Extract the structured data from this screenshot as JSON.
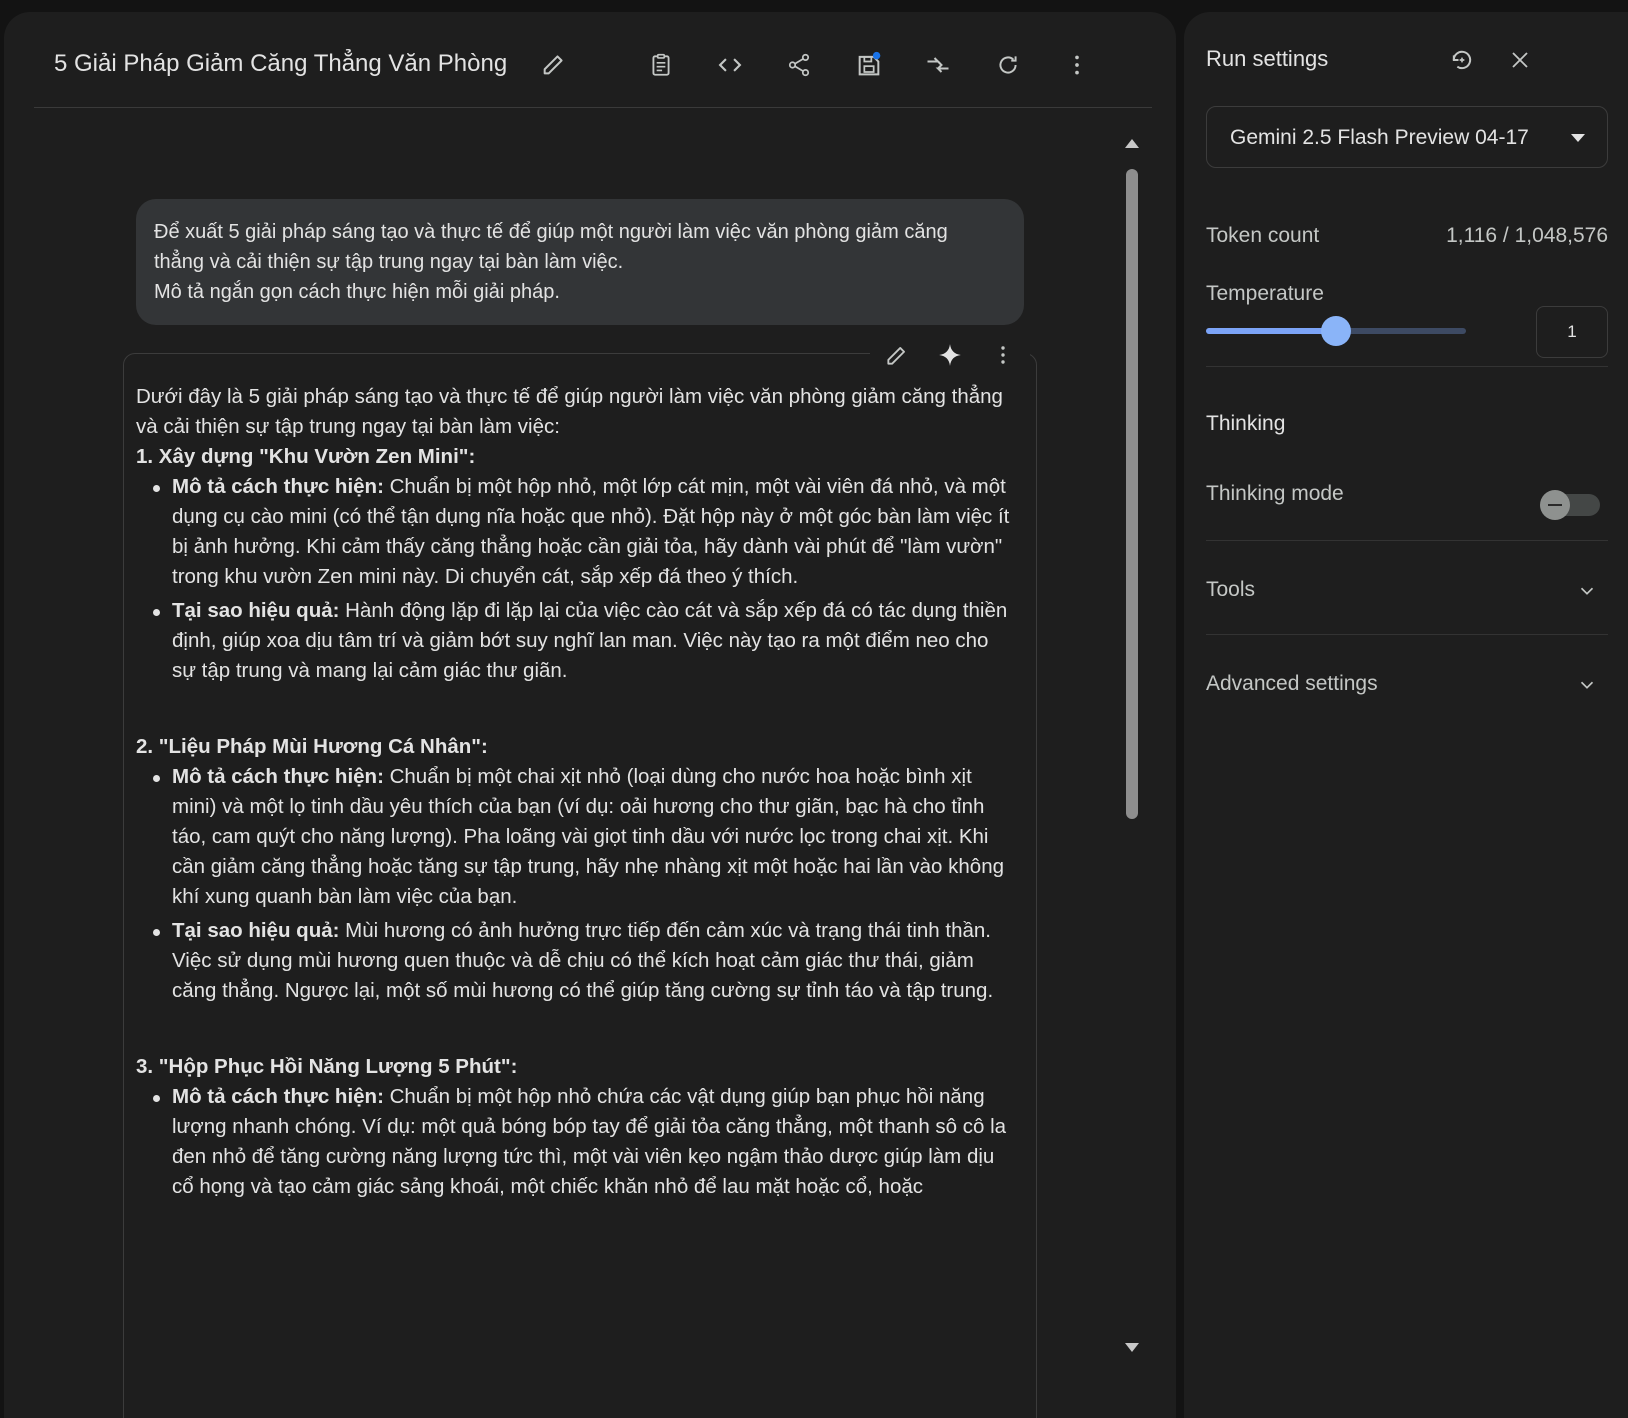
{
  "header": {
    "title": "5 Giải Pháp Giảm Căng Thẳng Văn Phòng",
    "icons": [
      "edit-icon",
      "clipboard-icon",
      "code-icon",
      "share-icon",
      "save-icon",
      "compare-icon",
      "refresh-icon",
      "more-vert-icon"
    ]
  },
  "user_prompt": {
    "lines": [
      "Để xuất 5 giải pháp sáng tạo và thực tế để giúp một người làm việc văn phòng giảm căng",
      "thẳng và cải thiện sự tập trung ngay tại bàn làm việc.",
      "Mô tả ngắn gọn cách thực hiện mỗi giải pháp."
    ]
  },
  "response": {
    "intro": "Dưới đây là 5 giải pháp sáng tạo và thực tế để giúp người làm việc văn phòng giảm căng thẳng và cải thiện sự tập trung ngay tại bàn làm việc:",
    "sections": [
      {
        "heading": "1. Xây dựng \"Khu Vườn Zen Mini\":",
        "bullets": [
          {
            "label": "Mô tả cách thực hiện:",
            "text": " Chuẩn bị một hộp nhỏ, một lớp cát mịn, một vài viên đá nhỏ, và một dụng cụ cào mini (có thể tận dụng nĩa hoặc que nhỏ). Đặt hộp này ở một góc bàn làm việc ít bị ảnh hưởng. Khi cảm thấy căng thẳng hoặc cần giải tỏa, hãy dành vài phút để \"làm vườn\" trong khu vườn Zen mini này. Di chuyển cát, sắp xếp đá theo ý thích."
          },
          {
            "label": "Tại sao hiệu quả:",
            "text": " Hành động lặp đi lặp lại của việc cào cát và sắp xếp đá có tác dụng thiền định, giúp xoa dịu tâm trí và giảm bớt suy nghĩ lan man. Việc này tạo ra một điểm neo cho sự tập trung và mang lại cảm giác thư giãn."
          }
        ]
      },
      {
        "heading": "2. \"Liệu Pháp Mùi Hương Cá Nhân\":",
        "bullets": [
          {
            "label": "Mô tả cách thực hiện:",
            "text": " Chuẩn bị một chai xịt nhỏ (loại dùng cho nước hoa hoặc bình xịt mini) và một lọ tinh dầu yêu thích của bạn (ví dụ: oải hương cho thư giãn, bạc hà cho tỉnh táo, cam quýt cho năng lượng). Pha loãng vài giọt tinh dầu với nước lọc trong chai xịt. Khi cần giảm căng thẳng hoặc tăng sự tập trung, hãy nhẹ nhàng xịt một hoặc hai lần vào không khí xung quanh bàn làm việc của bạn."
          },
          {
            "label": "Tại sao hiệu quả:",
            "text": " Mùi hương có ảnh hưởng trực tiếp đến cảm xúc và trạng thái tinh thần. Việc sử dụng mùi hương quen thuộc và dễ chịu có thể kích hoạt cảm giác thư thái, giảm căng thẳng. Ngược lại, một số mùi hương có thể giúp tăng cường sự tỉnh táo và tập trung."
          }
        ]
      },
      {
        "heading": "3. \"Hộp Phục Hồi Năng Lượng 5 Phút\":",
        "bullets": [
          {
            "label": "Mô tả cách thực hiện:",
            "text": " Chuẩn bị một hộp nhỏ chứa các vật dụng giúp bạn phục hồi năng lượng nhanh chóng. Ví dụ: một quả bóng bóp tay để giải tỏa căng thẳng, một thanh sô cô la đen nhỏ để tăng cường năng lượng tức thì, một vài viên kẹo ngậm thảo dược giúp làm dịu cổ họng và tạo cảm giác sảng khoái, một chiếc khăn nhỏ để lau mặt hoặc cổ, hoặc"
          }
        ]
      }
    ]
  },
  "run_settings": {
    "title": "Run settings",
    "model": "Gemini 2.5 Flash Preview 04-17",
    "token_label": "Token count",
    "token_value": "1,116 / 1,048,576",
    "temperature_label": "Temperature",
    "temperature_value": "1",
    "temperature_fraction": 0.5,
    "thinking_heading": "Thinking",
    "thinking_mode_label": "Thinking mode",
    "thinking_mode_on": false,
    "tools_label": "Tools",
    "advanced_label": "Advanced settings"
  },
  "colors": {
    "background": "#131313",
    "panel": "#1e1e1e",
    "bubble": "#333537",
    "accent": "#8ab4f8"
  }
}
